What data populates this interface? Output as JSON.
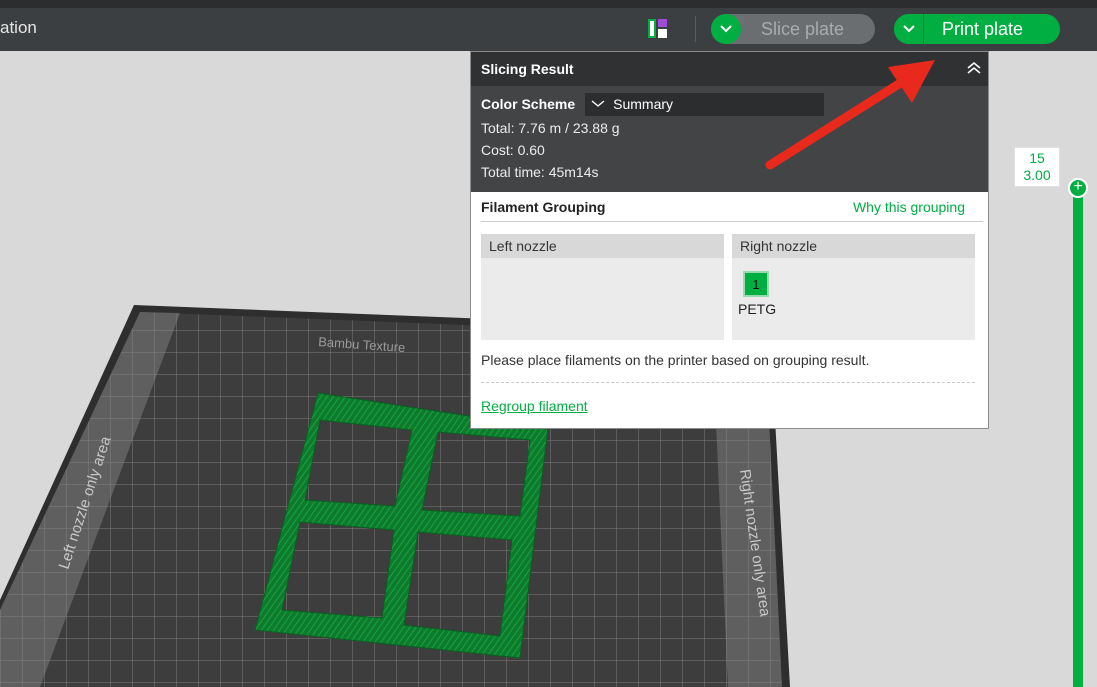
{
  "toolbar": {
    "title": "ation",
    "slice_label": "Slice plate",
    "print_label": "Print plate"
  },
  "bed": {
    "label_top": "Bambu Texture",
    "label_left": "Left nozzle only area",
    "label_right": "Right nozzle only area"
  },
  "panel": {
    "title": "Slicing Result",
    "color_scheme_label": "Color Scheme",
    "color_scheme_value": "Summary",
    "total": "Total:  7.76 m / 23.88 g",
    "cost": "Cost:  0.60",
    "time": "Total time:  45m14s",
    "grouping_title": "Filament Grouping",
    "why_link": "Why this grouping",
    "left_nozzle": "Left nozzle",
    "right_nozzle": "Right nozzle",
    "filament_number": "1",
    "filament_type": "PETG",
    "hint": "Please place filaments on the printer based on grouping result.",
    "regroup_link": "Regroup filament"
  },
  "layer_slider": {
    "layer": "15",
    "height": "3.00"
  },
  "colors": {
    "accent": "#00ae42",
    "toolbar_bg": "#3c3f41",
    "annotation_arrow": "#e8291c"
  }
}
